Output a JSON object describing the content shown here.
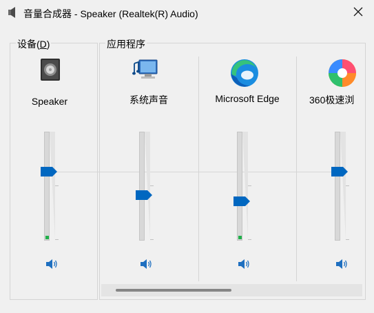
{
  "window": {
    "title": "音量合成器 - Speaker (Realtek(R) Audio)",
    "icon": "speaker-icon",
    "close_icon": "close-icon"
  },
  "device_group": {
    "label_text": "设备(",
    "label_access_key": "D",
    "label_close": ")",
    "name": "Speaker",
    "icon": "speaker-device-icon",
    "volume_fraction": 0.64,
    "mute_icon": "volume-icon"
  },
  "apps_group": {
    "label": "应用程序",
    "apps": [
      {
        "name": "系统声音",
        "icon": "system-sounds-icon",
        "volume_fraction": 0.42,
        "mute_icon": "volume-icon"
      },
      {
        "name": "Microsoft Edge",
        "icon": "edge-icon",
        "volume_fraction": 0.36,
        "mute_icon": "volume-icon"
      },
      {
        "name": "360极速浏",
        "icon": "360-browser-icon",
        "volume_fraction": 0.64,
        "mute_icon": "volume-icon"
      }
    ]
  },
  "colors": {
    "accent": "#0067c0",
    "meter_green": "#21b04b",
    "background": "#f0f0f0"
  }
}
